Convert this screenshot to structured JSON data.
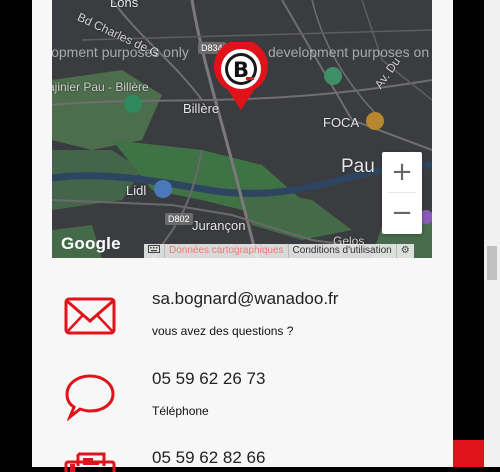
{
  "map": {
    "watermark_left": "lopment purposes only",
    "watermark_right": "development purposes on",
    "places": {
      "lons": "Lons",
      "billere": "Billère",
      "jurancon": "Jurançon",
      "pau": "Pau",
      "foca": "FOCA",
      "lidl": "Lidl",
      "gelos": "Gelos",
      "charles_de_gaulle": "Bd Charles de G",
      "pepiniere": "ajinier Pau - Billère",
      "av_du": "Av. Du"
    },
    "roads": {
      "d834": "D834",
      "d802": "D802"
    },
    "zoom_in": "+",
    "zoom_out": "−",
    "logo": "Google",
    "keyboard_icon": "keyboard-icon",
    "map_data": "Données cartographiques",
    "terms": "Conditions d'utilisation",
    "report": "⚙"
  },
  "marker": {
    "letter": "B",
    "colors": {
      "red": "#e0131b",
      "dark": "#1a1a1a"
    }
  },
  "contacts": [
    {
      "icon": "envelope-icon",
      "primary": "sa.bognard@wanadoo.fr",
      "secondary": "vous avez des questions ?"
    },
    {
      "icon": "speech-bubble-icon",
      "primary": "05 59 62 26 73",
      "secondary": "Téléphone"
    },
    {
      "icon": "fax-icon",
      "primary": "05 59 62 82 66",
      "secondary": ""
    }
  ],
  "accent_color": "#e0131b"
}
